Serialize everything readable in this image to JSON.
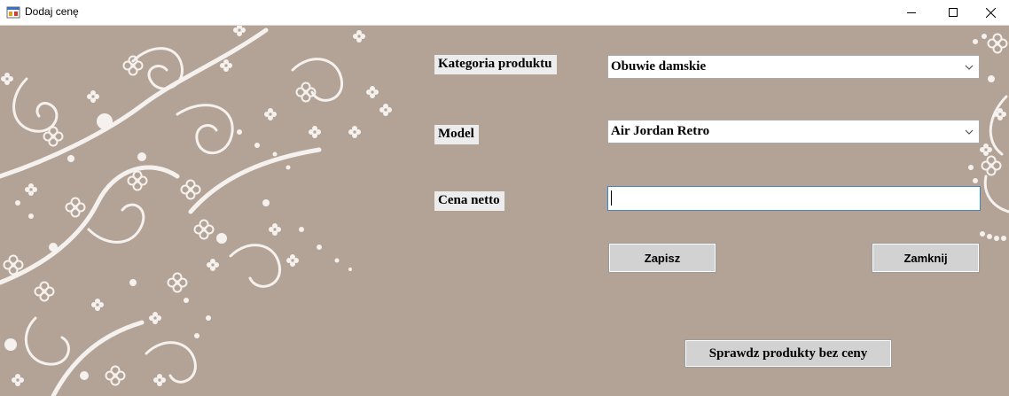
{
  "window": {
    "title": "Dodaj cenę",
    "icon": "app-icon"
  },
  "controls": {
    "minimize": "minimize-icon",
    "maximize": "maximize-icon",
    "close": "close-icon"
  },
  "form": {
    "category_label": "Kategoria produktu",
    "category_value": "Obuwie damskie",
    "model_label": "Model",
    "model_value": "Air Jordan Retro",
    "price_label": "Cena netto",
    "price_value": ""
  },
  "buttons": {
    "save": "Zapisz",
    "close": "Zamknij",
    "check": "Sprawdz produkty bez ceny"
  },
  "colors": {
    "background": "#b3a397",
    "ornament": "#f4f1ee",
    "button": "#d2d2d2",
    "label_bg": "#ececec",
    "focus_border": "#3f86d0"
  }
}
